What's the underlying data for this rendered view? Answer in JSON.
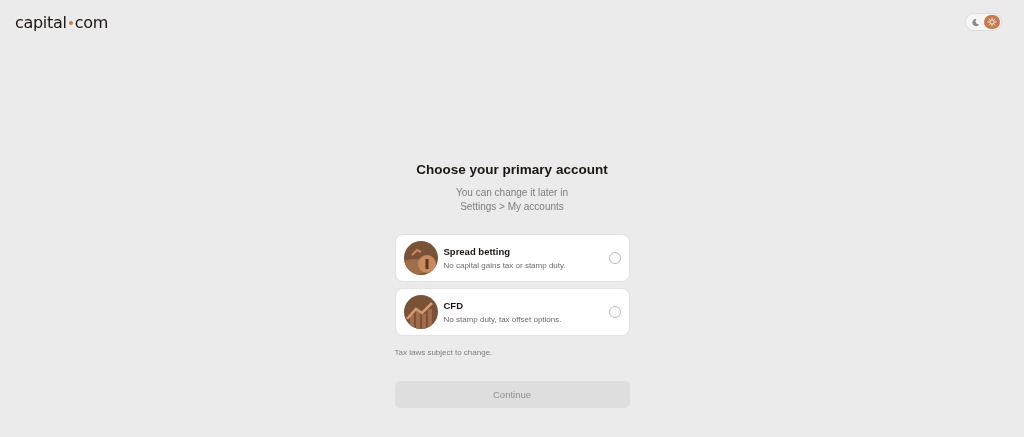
{
  "logo": {
    "left": "capital",
    "right": "com"
  },
  "theme_toggle": {
    "dark": false
  },
  "title": "Choose your primary account",
  "subtitle": [
    "You can change it later in",
    "Settings > My accounts"
  ],
  "accounts": [
    {
      "kind": "spread",
      "name": "Spread betting",
      "description": "No capital gains tax or stamp duty.",
      "selected": false
    },
    {
      "kind": "cfd",
      "name": "CFD",
      "description": "No stamp duty, tax offset options.",
      "selected": false
    }
  ],
  "note": "Tax laws subject to change.",
  "continue_button": {
    "label": "Continue",
    "disabled": true
  }
}
